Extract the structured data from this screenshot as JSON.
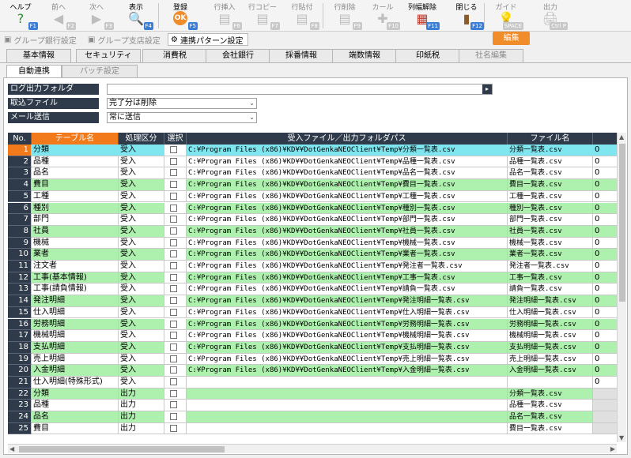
{
  "toolbar": {
    "buttons": [
      {
        "label": "ヘルプ",
        "fkey": "F1",
        "icon": "?",
        "disabled": false
      },
      {
        "label": "前へ",
        "fkey": "F2",
        "icon": "◀",
        "disabled": true
      },
      {
        "label": "次へ",
        "fkey": "F3",
        "icon": "▶",
        "disabled": true
      },
      {
        "label": "表示",
        "fkey": "F4",
        "icon": "🔍",
        "disabled": false
      },
      {
        "label": "登録",
        "fkey": "F5",
        "icon": "OK",
        "disabled": false
      },
      {
        "label": "行挿入",
        "fkey": "F6",
        "icon": "▤",
        "disabled": true
      },
      {
        "label": "行コピー",
        "fkey": "F7",
        "icon": "▤",
        "disabled": true
      },
      {
        "label": "行貼付",
        "fkey": "F8",
        "icon": "▤",
        "disabled": true
      },
      {
        "label": "行削除",
        "fkey": "F9",
        "icon": "▤",
        "disabled": true
      },
      {
        "label": "カール",
        "fkey": "F10",
        "icon": "✚",
        "disabled": true
      },
      {
        "label": "列幅解除",
        "fkey": "F11",
        "icon": "▦",
        "disabled": false
      },
      {
        "label": "閉じる",
        "fkey": "F12",
        "icon": "▮",
        "disabled": false
      },
      {
        "label": "ガイド",
        "fkey": "SPACE",
        "icon": "💡",
        "disabled": true
      },
      {
        "label": "出力",
        "fkey": "Ctrl P",
        "icon": "🖨",
        "disabled": true
      }
    ]
  },
  "subbar": {
    "group_bank": "グループ銀行設定",
    "group_branch": "グループ支店設定",
    "link_pattern": "連携パターン設定",
    "edit": "編集"
  },
  "tabs_top": [
    "基本情報",
    "セキュリティ",
    "消費税",
    "会社銀行",
    "採番情報",
    "端数情報",
    "印紙税",
    "社名編集"
  ],
  "tabs_sub": [
    "自動連携",
    "バッチ設定"
  ],
  "form": {
    "log_folder_label": "ログ出力フォルダ",
    "log_folder_value": "",
    "import_file_label": "取込ファイル",
    "import_file_value": "完了分は削除",
    "mail_label": "メール送信",
    "mail_value": "常に送信",
    "browse": "▸"
  },
  "grid": {
    "headers": [
      "No.",
      "テーブル名",
      "処理区分",
      "選択",
      "受入ファイル／出力フォルダパス",
      "ファイル名",
      ""
    ],
    "rows": [
      {
        "no": "1",
        "name": "分類",
        "kubun": "受入",
        "path": "C:¥Program Files (x86)¥KD¥¥DotGenkaNEOClient¥Temp¥分類一覧表.csv",
        "file": "分類一覧表.csv",
        "last": "0",
        "color": "cyan"
      },
      {
        "no": "2",
        "name": "品種",
        "kubun": "受入",
        "path": "C:¥Program Files (x86)¥KD¥¥DotGenkaNEOClient¥Temp¥品種一覧表.csv",
        "file": "品種一覧表.csv",
        "last": "0",
        "color": "white"
      },
      {
        "no": "3",
        "name": "品名",
        "kubun": "受入",
        "path": "C:¥Program Files (x86)¥KD¥¥DotGenkaNEOClient¥Temp¥品名一覧表.csv",
        "file": "品名一覧表.csv",
        "last": "0",
        "color": "white"
      },
      {
        "no": "4",
        "name": "費目",
        "kubun": "受入",
        "path": "C:¥Program Files (x86)¥KD¥¥DotGenkaNEOClient¥Temp¥費目一覧表.csv",
        "file": "費目一覧表.csv",
        "last": "0",
        "color": "green"
      },
      {
        "no": "5",
        "name": "工種",
        "kubun": "受入",
        "path": "C:¥Program Files (x86)¥KD¥¥DotGenkaNEOClient¥Temp¥工種一覧表.csv",
        "file": "工種一覧表.csv",
        "last": "0",
        "color": "white"
      },
      {
        "no": "6",
        "name": "種別",
        "kubun": "受入",
        "path": "C:¥Program Files (x86)¥KD¥¥DotGenkaNEOClient¥Temp¥種別一覧表.csv",
        "file": "種別一覧表.csv",
        "last": "0",
        "color": "green"
      },
      {
        "no": "7",
        "name": "部門",
        "kubun": "受入",
        "path": "C:¥Program Files (x86)¥KD¥¥DotGenkaNEOClient¥Temp¥部門一覧表.csv",
        "file": "部門一覧表.csv",
        "last": "0",
        "color": "white"
      },
      {
        "no": "8",
        "name": "社員",
        "kubun": "受入",
        "path": "C:¥Program Files (x86)¥KD¥¥DotGenkaNEOClient¥Temp¥社員一覧表.csv",
        "file": "社員一覧表.csv",
        "last": "0",
        "color": "green"
      },
      {
        "no": "9",
        "name": "機械",
        "kubun": "受入",
        "path": "C:¥Program Files (x86)¥KD¥¥DotGenkaNEOClient¥Temp¥機械一覧表.csv",
        "file": "機械一覧表.csv",
        "last": "0",
        "color": "white"
      },
      {
        "no": "10",
        "name": "業者",
        "kubun": "受入",
        "path": "C:¥Program Files (x86)¥KD¥¥DotGenkaNEOClient¥Temp¥業者一覧表.csv",
        "file": "業者一覧表.csv",
        "last": "0",
        "color": "green"
      },
      {
        "no": "11",
        "name": "注文者",
        "kubun": "受入",
        "path": "C:¥Program Files (x86)¥KD¥¥DotGenkaNEOClient¥Temp¥発注者一覧表.csv",
        "file": "発注者一覧表.csv",
        "last": "0",
        "color": "white"
      },
      {
        "no": "12",
        "name": "工事(基本情報)",
        "kubun": "受入",
        "path": "C:¥Program Files (x86)¥KD¥¥DotGenkaNEOClient¥Temp¥工事一覧表.csv",
        "file": "工事一覧表.csv",
        "last": "0",
        "color": "green"
      },
      {
        "no": "13",
        "name": "工事(請負情報)",
        "kubun": "受入",
        "path": "C:¥Program Files (x86)¥KD¥¥DotGenkaNEOClient¥Temp¥請負一覧表.csv",
        "file": "請負一覧表.csv",
        "last": "0",
        "color": "white"
      },
      {
        "no": "14",
        "name": "発注明細",
        "kubun": "受入",
        "path": "C:¥Program Files (x86)¥KD¥¥DotGenkaNEOClient¥Temp¥発注明細一覧表.csv",
        "file": "発注明細一覧表.csv",
        "last": "0",
        "color": "green"
      },
      {
        "no": "15",
        "name": "仕入明細",
        "kubun": "受入",
        "path": "C:¥Program Files (x86)¥KD¥¥DotGenkaNEOClient¥Temp¥仕入明細一覧表.csv",
        "file": "仕入明細一覧表.csv",
        "last": "0",
        "color": "white"
      },
      {
        "no": "16",
        "name": "労務明細",
        "kubun": "受入",
        "path": "C:¥Program Files (x86)¥KD¥¥DotGenkaNEOClient¥Temp¥労務明細一覧表.csv",
        "file": "労務明細一覧表.csv",
        "last": "0",
        "color": "green"
      },
      {
        "no": "17",
        "name": "機械明細",
        "kubun": "受入",
        "path": "C:¥Program Files (x86)¥KD¥¥DotGenkaNEOClient¥Temp¥機械明細一覧表.csv",
        "file": "機械明細一覧表.csv",
        "last": "0",
        "color": "white"
      },
      {
        "no": "18",
        "name": "支払明細",
        "kubun": "受入",
        "path": "C:¥Program Files (x86)¥KD¥¥DotGenkaNEOClient¥Temp¥支払明細一覧表.csv",
        "file": "支払明細一覧表.csv",
        "last": "0",
        "color": "green"
      },
      {
        "no": "19",
        "name": "売上明細",
        "kubun": "受入",
        "path": "C:¥Program Files (x86)¥KD¥¥DotGenkaNEOClient¥Temp¥売上明細一覧表.csv",
        "file": "売上明細一覧表.csv",
        "last": "0",
        "color": "white"
      },
      {
        "no": "20",
        "name": "入金明細",
        "kubun": "受入",
        "path": "C:¥Program Files (x86)¥KD¥¥DotGenkaNEOClient¥Temp¥入金明細一覧表.csv",
        "file": "入金明細一覧表.csv",
        "last": "0",
        "color": "green"
      },
      {
        "no": "21",
        "name": "仕入明細(特殊形式)",
        "kubun": "受入",
        "path": "",
        "file": "",
        "last": "0",
        "color": "white"
      },
      {
        "no": "22",
        "name": "分類",
        "kubun": "出力",
        "path": "",
        "file": "分類一覧表.csv",
        "last": "",
        "color": "green"
      },
      {
        "no": "23",
        "name": "品種",
        "kubun": "出力",
        "path": "",
        "file": "品種一覧表.csv",
        "last": "",
        "color": "white"
      },
      {
        "no": "24",
        "name": "品名",
        "kubun": "出力",
        "path": "",
        "file": "品名一覧表.csv",
        "last": "",
        "color": "green"
      },
      {
        "no": "25",
        "name": "費目",
        "kubun": "出力",
        "path": "",
        "file": "費目一覧表.csv",
        "last": "",
        "color": "white"
      }
    ]
  },
  "colors": {
    "header": "#2f3b4a",
    "accent": "#f27a1a",
    "row_green": "#aef0ae",
    "row_selected": "#7fe6f0"
  }
}
